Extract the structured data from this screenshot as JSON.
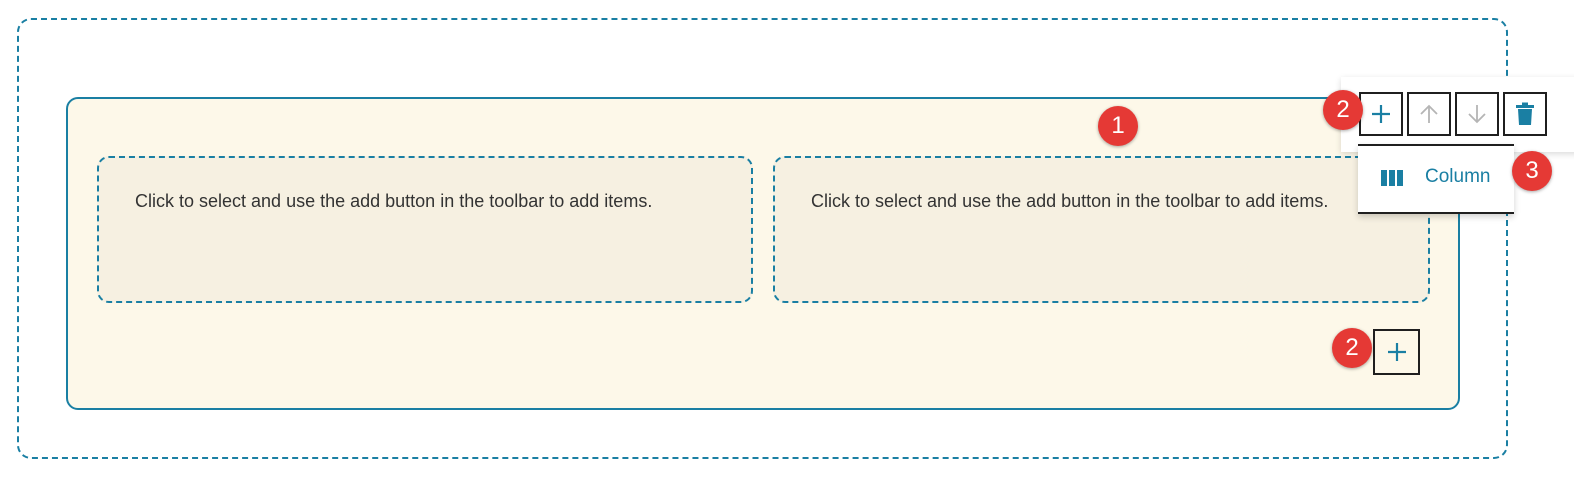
{
  "columns": [
    {
      "placeholder": "Click to select and use the add button in the toolbar to add items."
    },
    {
      "placeholder": "Click to select and use the add button in the toolbar to add items."
    }
  ],
  "toolbar": {
    "buttons": [
      {
        "icon": "plus-icon",
        "enabled": true
      },
      {
        "icon": "arrow-up-icon",
        "enabled": false
      },
      {
        "icon": "arrow-down-icon",
        "enabled": false
      },
      {
        "icon": "trash-icon",
        "enabled": true
      }
    ]
  },
  "add_menu": {
    "items": [
      {
        "label": "Column",
        "icon": "columns-icon"
      }
    ]
  },
  "callouts": {
    "row": "1",
    "add_toolbar": "2",
    "menu": "3",
    "add_bottom": "2"
  },
  "colors": {
    "accent": "#1a7fa3",
    "row_background": "#fdf8e9",
    "column_background": "#f6f0e1",
    "callout": "#e53935",
    "disabled_icon": "#b5b5b5"
  }
}
